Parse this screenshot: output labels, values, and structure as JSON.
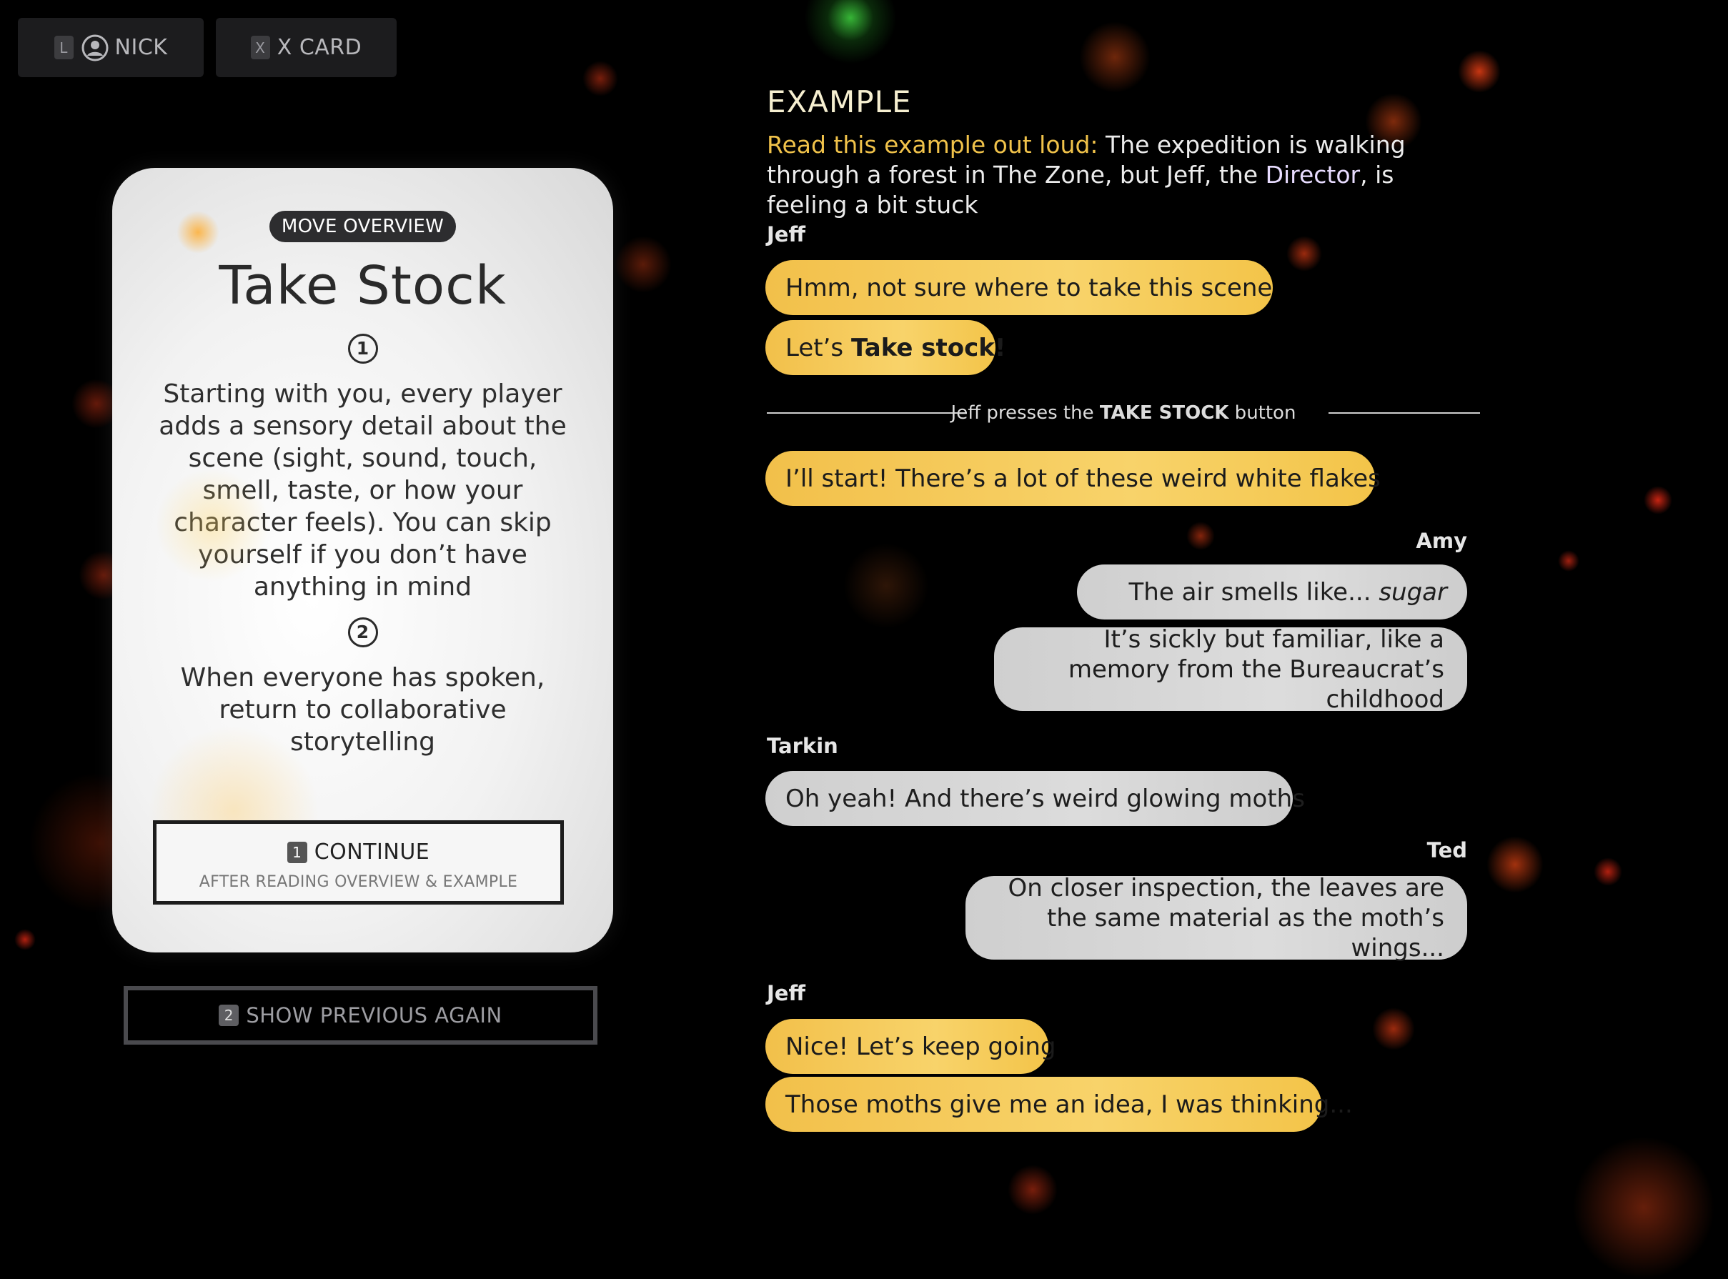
{
  "topbar": {
    "nick": {
      "key": "L",
      "label": "NICK"
    },
    "xcard": {
      "key": "X",
      "label": "X CARD"
    }
  },
  "card": {
    "badge": "MOVE OVERVIEW",
    "title": "Take Stock",
    "steps": [
      {
        "num": "1",
        "text": "Starting with you, every player adds a sensory detail about the scene (sight, sound, touch, smell, taste, or how your character feels). You can skip yourself if you don’t have anything in mind"
      },
      {
        "num": "2",
        "text": "When everyone has spoken, return to collaborative storytelling"
      }
    ],
    "continue": {
      "key": "1",
      "label": "CONTINUE",
      "sub": "AFTER READING OVERVIEW & EXAMPLE"
    }
  },
  "show_previous": {
    "key": "2",
    "label": "SHOW PREVIOUS AGAIN"
  },
  "example": {
    "heading": "EXAMPLE",
    "intro": {
      "lead": "Read this example out loud:",
      "text_before": " The expedition is walking through a forest in The Zone, but Jeff, the ",
      "director": "Director",
      "text_after": ", is feeling a bit stuck"
    },
    "divider": {
      "before": "Jeff presses the ",
      "bold": "TAKE STOCK",
      "after": " button"
    },
    "speakers": {
      "jeff": "Jeff",
      "amy": "Amy",
      "tarkin": "Tarkin",
      "ted": "Ted"
    },
    "messages": {
      "jeff1": "Hmm, not sure where to take this scene",
      "jeff2_pre": "Let’s ",
      "jeff2_bold": "Take stock!",
      "jeff3": "I’ll start! There’s a lot of these weird white flakes",
      "amy1_pre": "The air smells like... ",
      "amy1_em": "sugar",
      "amy2": "It’s sickly but familiar, like a memory from the Bureaucrat’s childhood",
      "tarkin1": "Oh yeah! And there’s weird glowing moths",
      "ted1": "On closer inspection, the leaves are the same material as the moth’s wings...",
      "jeff4": "Nice! Let’s keep going",
      "jeff5": "Those moths give me an idea, I was thinking..."
    }
  }
}
